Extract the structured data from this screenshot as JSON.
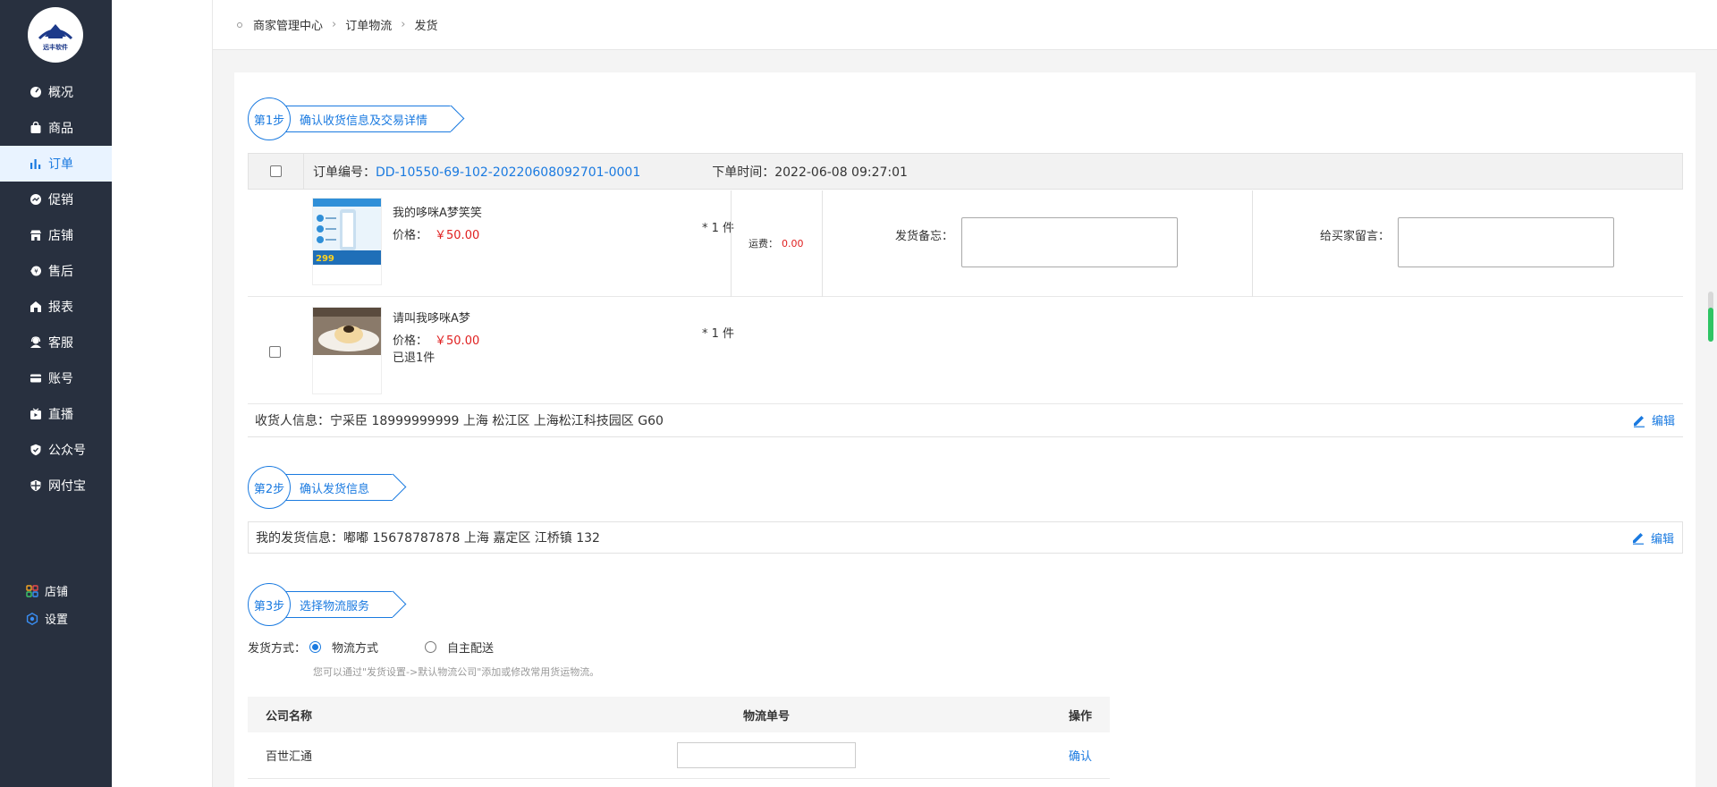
{
  "logo": {
    "text": "远丰软件"
  },
  "nav": {
    "items": [
      {
        "label": "概况",
        "icon": "dashboard-icon"
      },
      {
        "label": "商品",
        "icon": "bag-icon"
      },
      {
        "label": "订单",
        "icon": "bar-chart-icon",
        "active": true
      },
      {
        "label": "促销",
        "icon": "promo-icon"
      },
      {
        "label": "店铺",
        "icon": "store-icon"
      },
      {
        "label": "售后",
        "icon": "aftersale-icon"
      },
      {
        "label": "报表",
        "icon": "report-icon"
      },
      {
        "label": "客服",
        "icon": "service-icon"
      },
      {
        "label": "账号",
        "icon": "account-icon"
      },
      {
        "label": "直播",
        "icon": "live-icon"
      },
      {
        "label": "公众号",
        "icon": "wechat-icon"
      },
      {
        "label": "网付宝",
        "icon": "shield-icon"
      }
    ],
    "bottom": [
      {
        "label": "店铺",
        "icon": "grid-icon"
      },
      {
        "label": "设置",
        "icon": "settings-icon"
      }
    ]
  },
  "breadcrumb": [
    "商家管理中心",
    "订单物流",
    "发货"
  ],
  "steps": [
    {
      "num": "第1步",
      "label": "确认收货信息及交易详情"
    },
    {
      "num": "第2步",
      "label": "确认发货信息"
    },
    {
      "num": "第3步",
      "label": "选择物流服务"
    }
  ],
  "order": {
    "no_label": "订单编号：",
    "no": "DD-10550-69-102-20220608092701-0001",
    "time_label": "下单时间：",
    "time": "2022-06-08 09:27:01",
    "products": [
      {
        "name": "我的哆咪A梦笑笑",
        "price_label": "价格：",
        "price": "￥50.00",
        "qty": "* 1 件",
        "note": ""
      },
      {
        "name": "请叫我哆咪A梦",
        "price_label": "价格：",
        "price": "￥50.00",
        "qty": "* 1 件",
        "note": "已退1件"
      }
    ],
    "ship_fee_label": "运费：",
    "ship_fee": "0.00",
    "memo_label": "发货备忘：",
    "buyer_msg_label": "给买家留言："
  },
  "receiver": {
    "label": "收货人信息：",
    "value": "宁采臣 18999999999  上海 松江区 上海松江科技园区 G60",
    "edit": "编辑"
  },
  "sender": {
    "label": "我的发货信息：",
    "value": "嘟嘟 15678787878 上海 嘉定区 江桥镇 132",
    "edit": "编辑"
  },
  "shipping": {
    "mode_label": "发货方式：",
    "option1": "物流方式",
    "option2": "自主配送",
    "selected": "物流方式",
    "hint": "您可以通过\"发货设置->默认物流公司\"添加或修改常用货运物流。"
  },
  "logistics_table": {
    "headers": [
      "公司名称",
      "物流单号",
      "操作"
    ],
    "rows": [
      {
        "company": "百世汇通",
        "tracking_no": "",
        "action": "确认"
      }
    ]
  },
  "colors": {
    "primary": "#1a7ae0",
    "sidebar": "#28303f",
    "price": "#e02020"
  }
}
